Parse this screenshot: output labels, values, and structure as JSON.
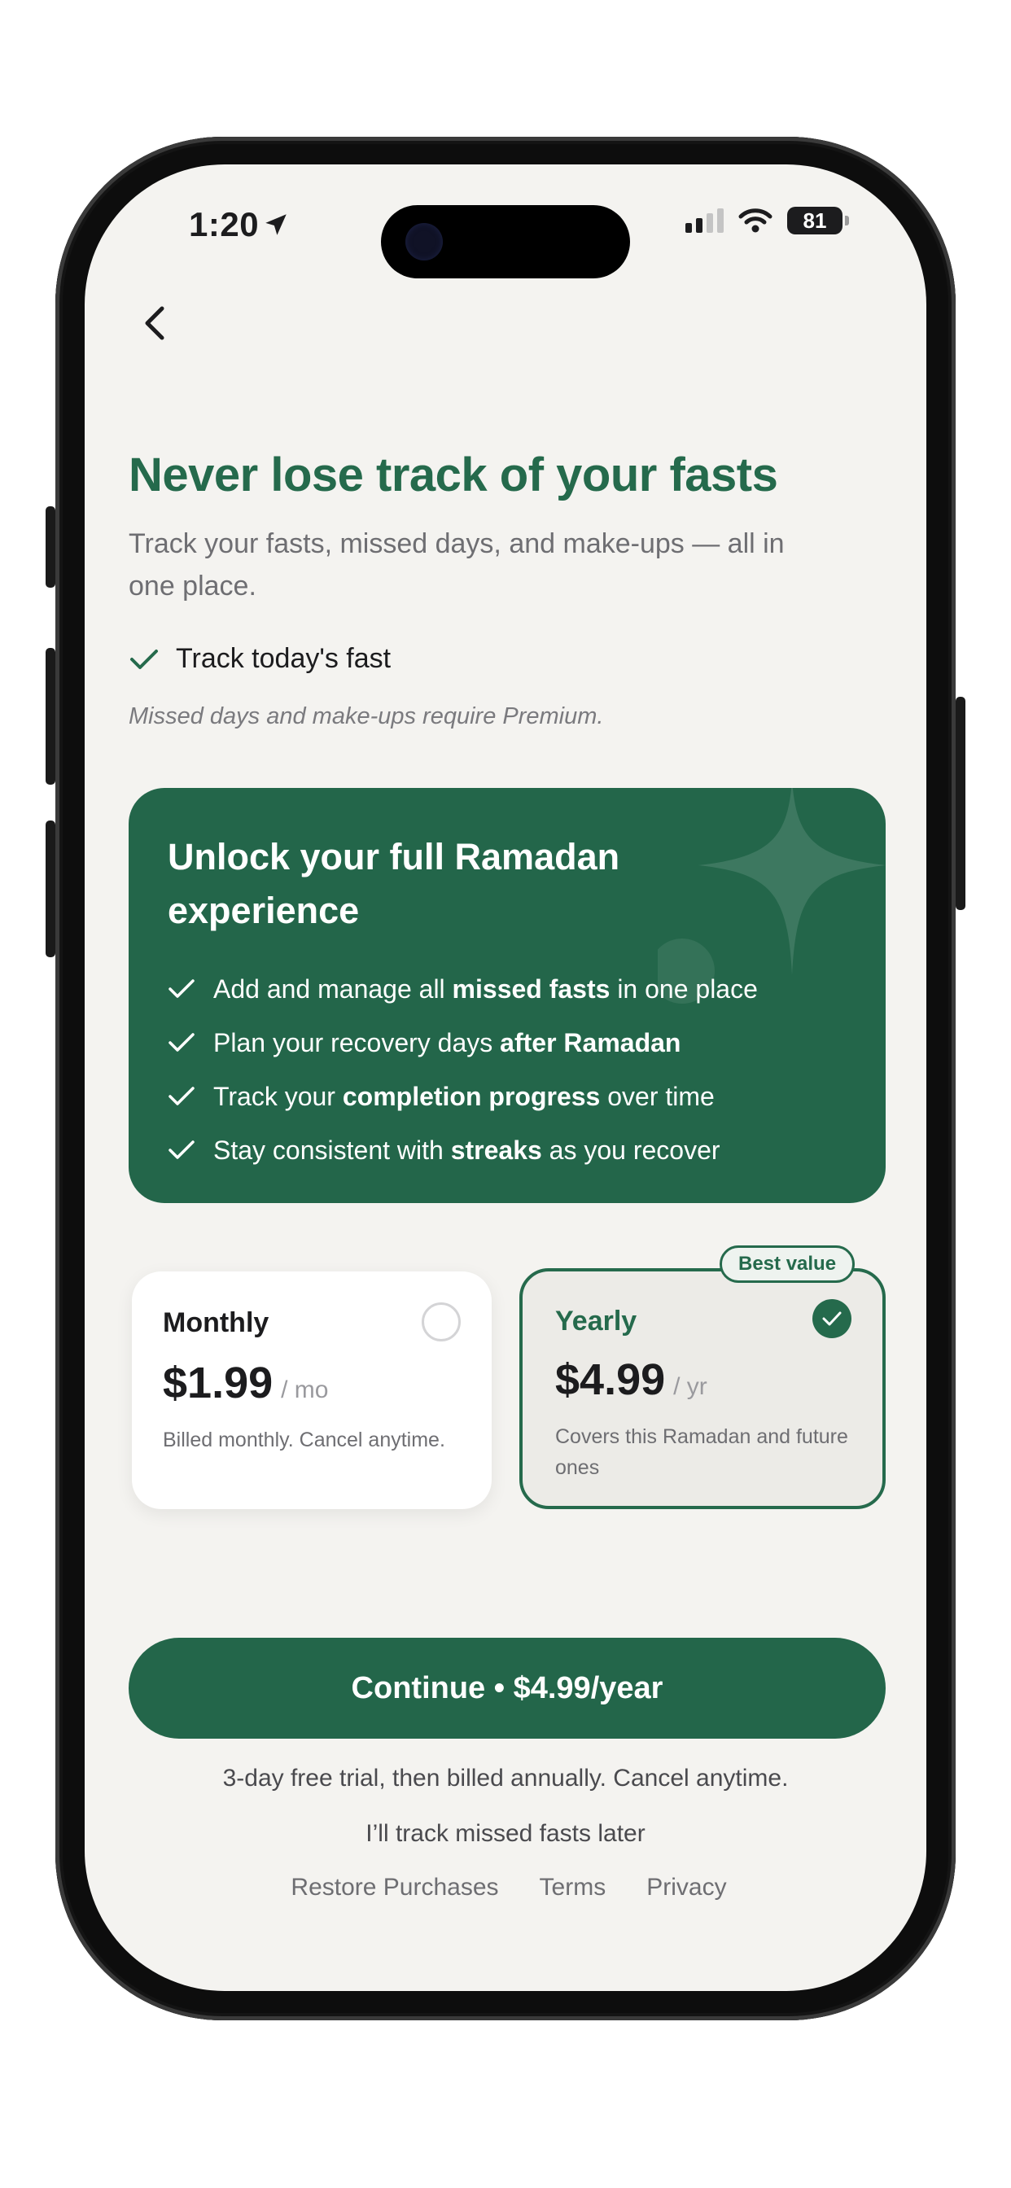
{
  "status_bar": {
    "time": "1:20",
    "battery": "81"
  },
  "header": {
    "title": "Never lose track of your fasts",
    "subtitle": "Track your fasts, missed days, and make-ups — all in one place.",
    "free_feature": "Track today's fast",
    "premium_note": "Missed days and make-ups require Premium."
  },
  "premium_card": {
    "title": "Unlock your full Ramadan experience",
    "benefits": [
      {
        "pre": "Add and manage all ",
        "bold": "missed fasts",
        "post": " in one place"
      },
      {
        "pre": "Plan your recovery days ",
        "bold": "after Ramadan",
        "post": ""
      },
      {
        "pre": "Track your ",
        "bold": "completion progress",
        "post": " over time"
      },
      {
        "pre": "Stay consistent with ",
        "bold": "streaks",
        "post": " as you recover"
      }
    ]
  },
  "plans": {
    "monthly": {
      "name": "Monthly",
      "price": "$1.99",
      "period": "/ mo",
      "description": "Billed monthly. Cancel anytime.",
      "selected": false
    },
    "yearly": {
      "name": "Yearly",
      "price": "$4.99",
      "period": "/ yr",
      "description": "Covers this Ramadan and future ones",
      "selected": true,
      "badge": "Best value"
    }
  },
  "cta": {
    "label": "Continue • $4.99/year"
  },
  "trial_note": "3-day free trial, then billed annually. Cancel anytime.",
  "later_link": "I’ll track missed fasts later",
  "footer": {
    "restore": "Restore Purchases",
    "terms": "Terms",
    "privacy": "Privacy"
  },
  "colors": {
    "brand_green": "#23664a",
    "background": "#f4f3f0",
    "text_primary": "#1c1c1e",
    "text_secondary": "#6e6e72"
  },
  "icons": [
    "back-chevron-icon",
    "location-arrow-icon",
    "signal-icon",
    "wifi-icon",
    "battery-icon",
    "check-icon",
    "sparkle-icon"
  ]
}
